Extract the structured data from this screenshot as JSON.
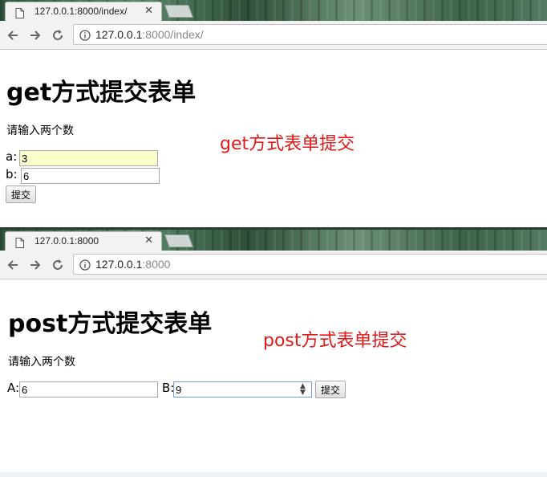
{
  "window_get": {
    "tab_title": "127.0.0.1:8000/index/",
    "url_host": "127.0.0.1",
    "url_rest": ":8000/index/",
    "heading": "get方式提交表单",
    "prompt": "请输入两个数",
    "annotation": "get方式表单提交",
    "field_a_label": "a:",
    "field_a_value": "3",
    "field_b_label": "b:",
    "field_b_value": "6",
    "submit_label": "提交"
  },
  "window_post": {
    "tab_title": "127.0.0.1:8000",
    "url_host": "127.0.0.1",
    "url_rest": ":8000",
    "heading": "post方式提交表单",
    "prompt": "请输入两个数",
    "annotation": "post方式表单提交",
    "field_a_label": "A:",
    "field_a_value": "6",
    "field_b_label": "B:",
    "field_b_value": "9",
    "submit_label": "提交"
  },
  "icons": {
    "tab_page": "page-icon",
    "tab_close": "close-icon",
    "back": "arrow-left-icon",
    "forward": "arrow-right-icon",
    "reload": "reload-icon",
    "site_info": "info-icon",
    "spinner": "spin-arrows-icon"
  },
  "colors": {
    "annotation": "#e31818",
    "autofill_bg": "#fafdc9",
    "focus_border": "#6f9ae6"
  }
}
